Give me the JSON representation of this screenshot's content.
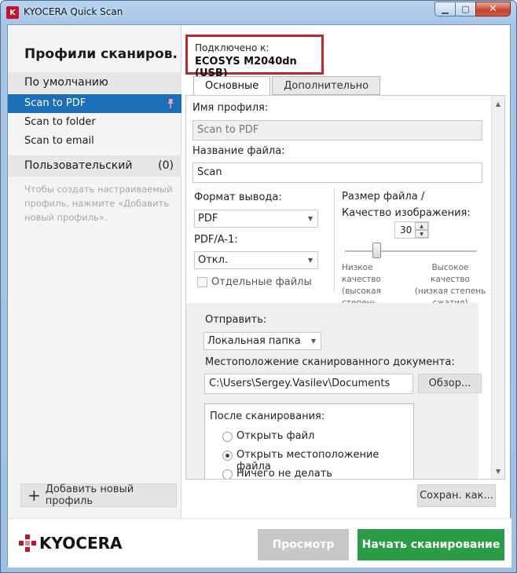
{
  "window": {
    "title": "KYOCERA Quick Scan"
  },
  "sidebar": {
    "title": "Профили сканиров.",
    "default_group": "По умолчанию",
    "items": [
      "Scan to PDF",
      "Scan to folder",
      "Scan to email"
    ],
    "custom_group": "Пользовательский",
    "custom_count": "(0)",
    "hint": "Чтобы создать настраиваемый профиль, нажмите «Добавить новый профиль».",
    "add_button": "Добавить новый профиль"
  },
  "connection": {
    "label": "Подключено к:",
    "device": "ECOSYS M2040dn (USB)"
  },
  "tabs": [
    "Основные",
    "Дополнительно"
  ],
  "form": {
    "profile_name_label": "Имя профиля:",
    "profile_name_value": "Scan to PDF",
    "file_name_label": "Название файла:",
    "file_name_value": "Scan",
    "output_format_label": "Формат вывода:",
    "output_format_value": "PDF",
    "pdfa_label": "PDF/A-1:",
    "pdfa_value": "Откл.",
    "separate_files_label": "Отдельные файлы",
    "size_quality_label": "Размер файла / Качество изображения:",
    "quality_value": "30",
    "low_quality": "Низкое качество (высокая степень сжатия)",
    "high_quality": "Высокое качество (низкая степень сжатия)",
    "quality_slider_fraction": 0.3,
    "send_label": "Отправить:",
    "send_value": "Локальная папка",
    "location_label": "Местоположение сканированного документа:",
    "location_value": "C:\\Users\\Sergey.Vasilev\\Documents",
    "browse_button": "Обзор...",
    "after_scan_label": "После сканирования:",
    "after_scan_options": [
      "Открыть файл",
      "Открыть местоположение файла",
      "Ничего не делать"
    ],
    "after_scan_selected": 1
  },
  "save_as_button": "Сохран. как...",
  "footer": {
    "brand": "KYOCERA",
    "preview_button": "Просмотр",
    "scan_button": "Начать сканирование"
  },
  "colors": {
    "accent": "#1b6fb9",
    "scan_button": "#2a9d44",
    "highlight_border": "#c0282d"
  }
}
